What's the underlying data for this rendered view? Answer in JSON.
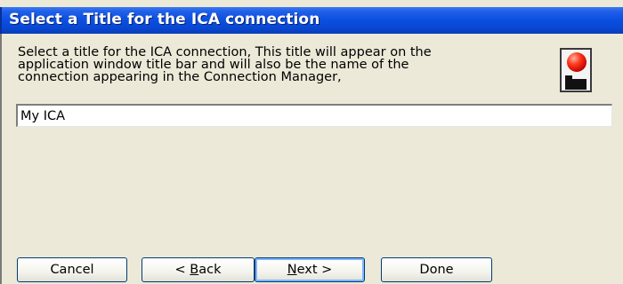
{
  "window": {
    "title": "Select a Title for the ICA connection"
  },
  "description": {
    "line1": "Select a title for the ICA connection, This title will appear on the",
    "line2": "application window title bar and will also be the name of the",
    "line3": "connection appearing in the Connection Manager,"
  },
  "icon": {
    "name": "citrix-ica-icon"
  },
  "title_field": {
    "value": "My ICA"
  },
  "buttons": {
    "cancel": "Cancel",
    "back_prefix": "< ",
    "back_accel": "B",
    "back_rest": "ack",
    "next_accel": "N",
    "next_rest": "ext >",
    "done": "Done"
  },
  "colors": {
    "titlebar": "#0a4fe0",
    "dialog_background": "#ece9d8",
    "button_border": "#003c74"
  }
}
